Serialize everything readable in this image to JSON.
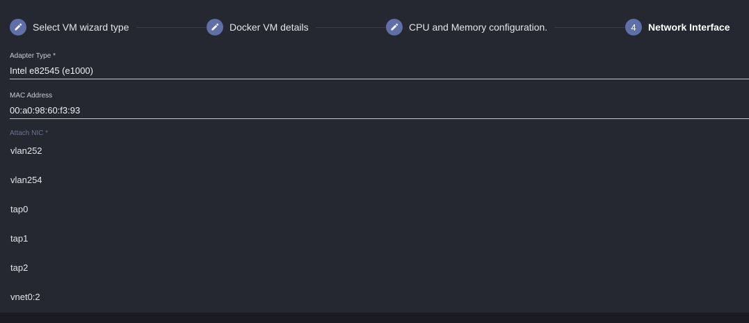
{
  "stepper": {
    "steps": [
      {
        "label": "Select VM wizard type",
        "state": "done",
        "icon": "pencil-icon"
      },
      {
        "label": "Docker VM details",
        "state": "done",
        "icon": "pencil-icon"
      },
      {
        "label": "CPU and Memory configuration.",
        "state": "done",
        "icon": "pencil-icon"
      },
      {
        "label": "Network Interface",
        "state": "active",
        "number": "4"
      }
    ]
  },
  "form": {
    "adapter_type": {
      "label": "Adapter Type *",
      "value": "Intel e82545 (e1000)"
    },
    "mac_address": {
      "label": "MAC Address",
      "value": "00:a0:98:60:f3:93"
    },
    "attach_nic": {
      "label": "Attach NIC *"
    }
  },
  "dropdown": {
    "options": [
      "vlan252",
      "vlan254",
      "tap0",
      "tap1",
      "tap2",
      "vnet0:2"
    ]
  },
  "colors": {
    "background": "#262831",
    "step_circle": "#5f6fa8",
    "text": "#e3e5ea"
  }
}
